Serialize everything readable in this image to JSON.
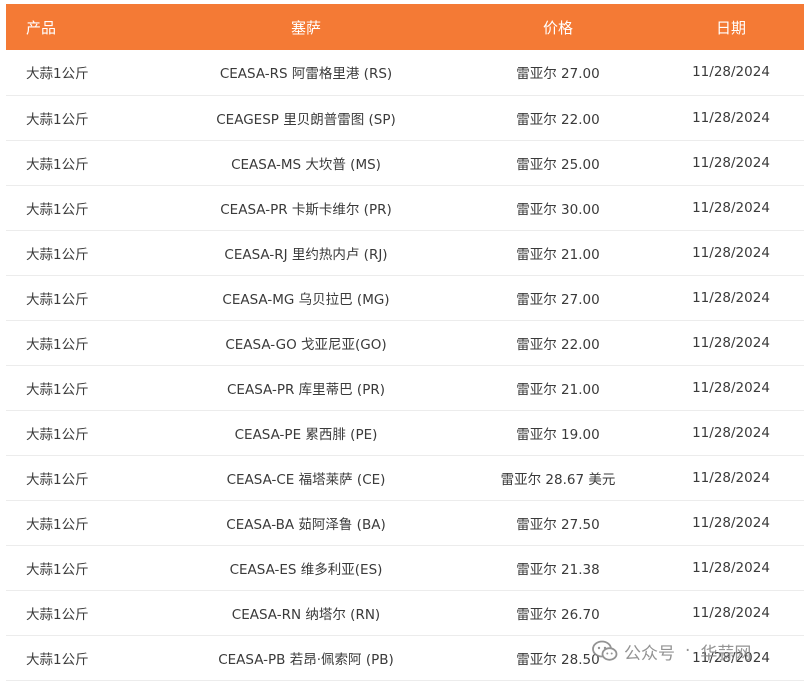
{
  "colors": {
    "header_bg": "#f47a35",
    "header_text": "#ffffff",
    "row_border": "#ececec",
    "cell_text": "#3a3a3a"
  },
  "table": {
    "headers": {
      "product": "产品",
      "ceasa": "塞萨",
      "price": "价格",
      "date": "日期"
    },
    "rows": [
      {
        "product": "大蒜1公斤",
        "ceasa": "CEASA-RS 阿雷格里港 (RS)",
        "price": "雷亚尔 27.00",
        "date": "11/28/2024"
      },
      {
        "product": "大蒜1公斤",
        "ceasa": "CEAGESP 里贝朗普雷图 (SP)",
        "price": "雷亚尔 22.00",
        "date": "11/28/2024"
      },
      {
        "product": "大蒜1公斤",
        "ceasa": "CEASA-MS 大坎普 (MS)",
        "price": "雷亚尔 25.00",
        "date": "11/28/2024"
      },
      {
        "product": "大蒜1公斤",
        "ceasa": "CEASA-PR 卡斯卡维尔 (PR)",
        "price": "雷亚尔 30.00",
        "date": "11/28/2024"
      },
      {
        "product": "大蒜1公斤",
        "ceasa": "CEASA-RJ 里约热内卢 (RJ)",
        "price": "雷亚尔 21.00",
        "date": "11/28/2024"
      },
      {
        "product": "大蒜1公斤",
        "ceasa": "CEASA-MG 乌贝拉巴 (MG)",
        "price": "雷亚尔 27.00",
        "date": "11/28/2024"
      },
      {
        "product": "大蒜1公斤",
        "ceasa": "CEASA-GO 戈亚尼亚(GO)",
        "price": "雷亚尔 22.00",
        "date": "11/28/2024"
      },
      {
        "product": "大蒜1公斤",
        "ceasa": "CEASA-PR 库里蒂巴 (PR)",
        "price": "雷亚尔 21.00",
        "date": "11/28/2024"
      },
      {
        "product": "大蒜1公斤",
        "ceasa": "CEASA-PE 累西腓 (PE)",
        "price": "雷亚尔 19.00",
        "date": "11/28/2024"
      },
      {
        "product": "大蒜1公斤",
        "ceasa": "CEASA-CE 福塔莱萨 (CE)",
        "price": "雷亚尔 28.67 美元",
        "date": "11/28/2024"
      },
      {
        "product": "大蒜1公斤",
        "ceasa": "CEASA-BA 茹阿泽鲁 (BA)",
        "price": "雷亚尔 27.50",
        "date": "11/28/2024"
      },
      {
        "product": "大蒜1公斤",
        "ceasa": "CEASA-ES 维多利亚(ES)",
        "price": "雷亚尔 21.38",
        "date": "11/28/2024"
      },
      {
        "product": "大蒜1公斤",
        "ceasa": "CEASA-RN 纳塔尔 (RN)",
        "price": "雷亚尔 26.70",
        "date": "11/28/2024"
      },
      {
        "product": "大蒜1公斤",
        "ceasa": "CEASA-PB 若昂·佩索阿 (PB)",
        "price": "雷亚尔 28.50",
        "date": "11/28/2024"
      }
    ]
  },
  "watermark": {
    "icon": "wechat-icon",
    "label": "公众号",
    "separator": "·",
    "name": "华蒜网"
  }
}
